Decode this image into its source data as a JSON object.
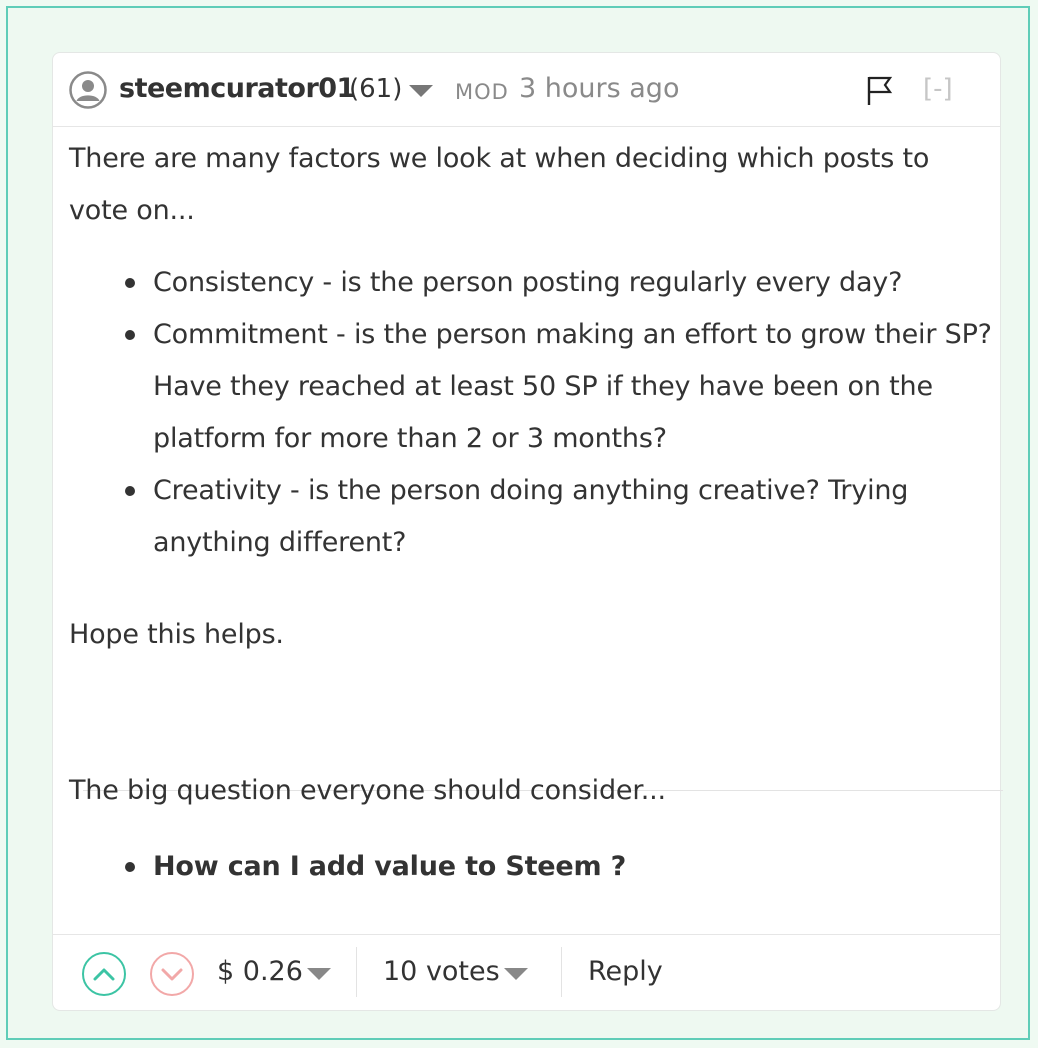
{
  "comment": {
    "author": "steemcurator01",
    "reputation": "(61)",
    "role_badge": "MOD",
    "timestamp": "3 hours ago",
    "collapse_label": "[-]",
    "body": {
      "intro": "There are many factors we look at when deciding which posts to vote on...",
      "factors": [
        "Consistency - is the person posting regularly every day?",
        "Commitment - is the person making an effort to grow their SP? Have they reached at least 50 SP if they have been on the platform for more than 2 or 3 months?",
        "Creativity - is the person doing anything creative? Trying anything different?"
      ],
      "closing": "Hope this helps.",
      "question_intro": "The big question everyone should consider...",
      "question": "How can I add value to Steem ?"
    },
    "footer": {
      "payout": "$ 0.26",
      "votes": "10 votes",
      "reply_label": "Reply"
    }
  },
  "colors": {
    "accent_upvote": "#3cc4a4",
    "downvote": "#f2a8a8",
    "frame_border": "#5fcdb8"
  },
  "icons": {
    "avatar": "default-user-icon",
    "flag": "flag-icon",
    "upvote": "chevron-up-icon",
    "downvote": "chevron-down-icon"
  }
}
